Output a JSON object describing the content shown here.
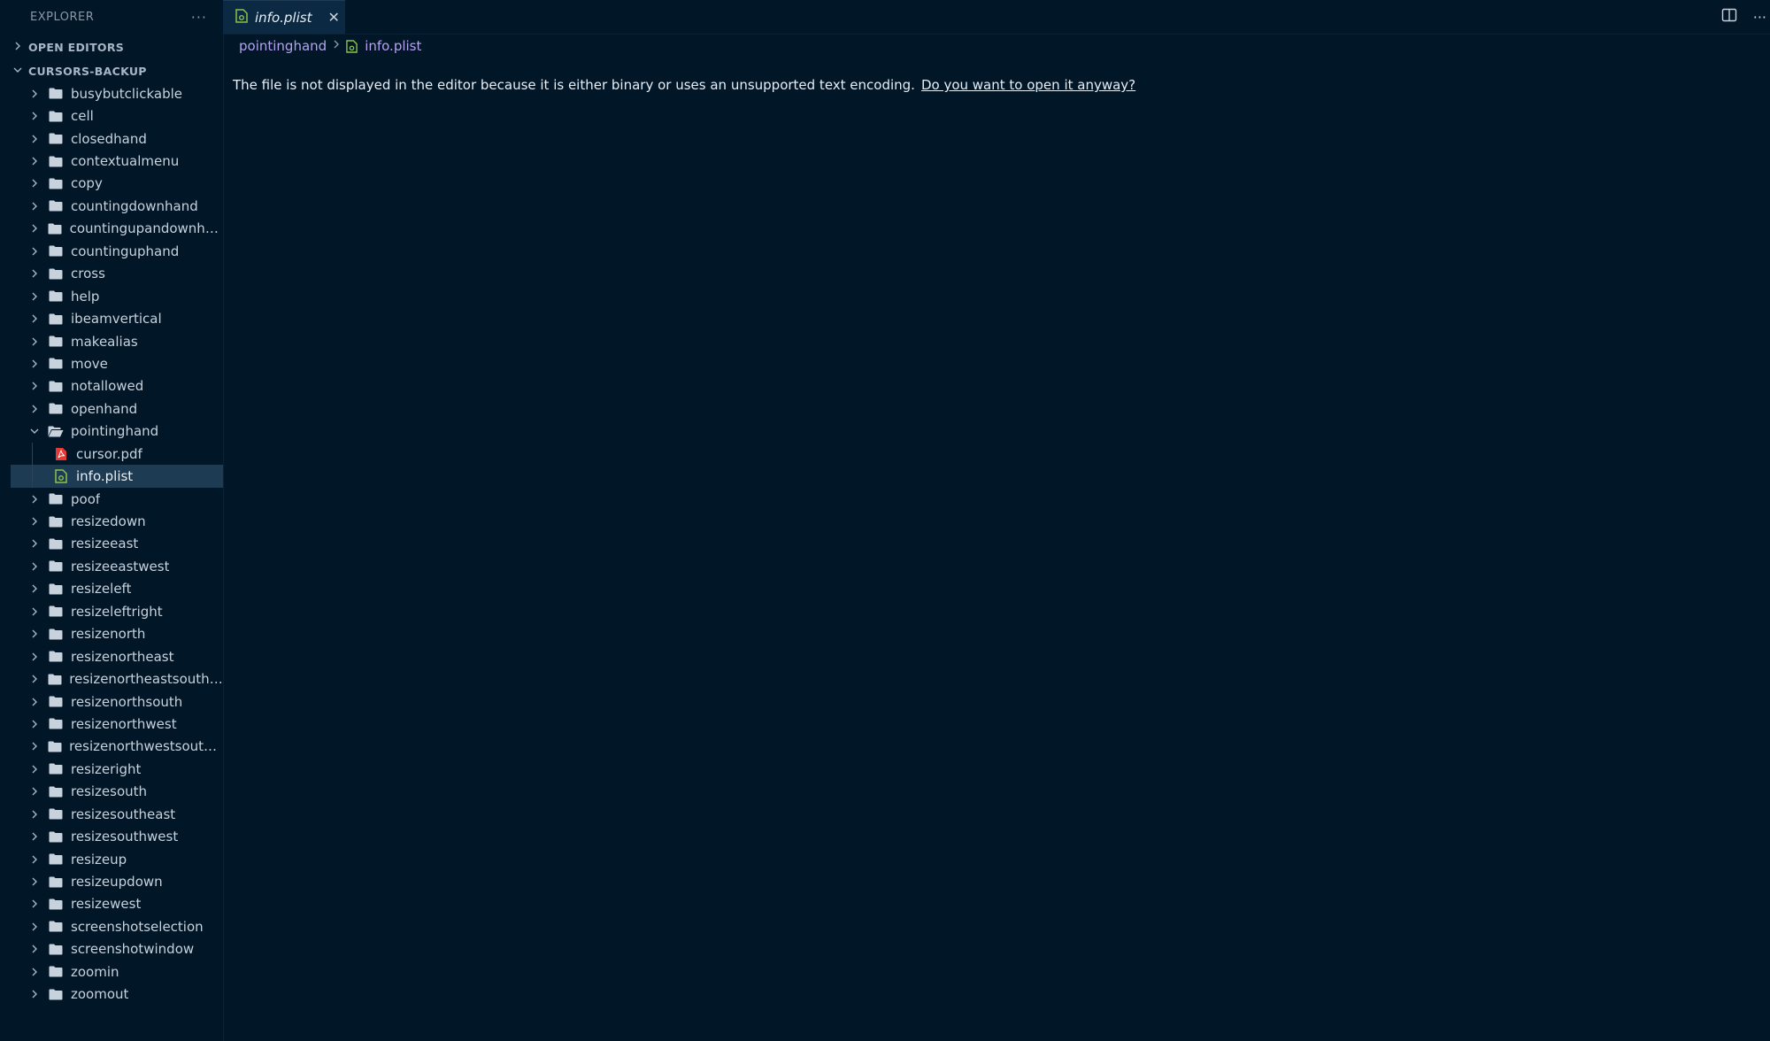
{
  "explorer": {
    "title": "EXPLORER",
    "more": "···"
  },
  "open_editors": {
    "label": "OPEN EDITORS"
  },
  "workspace": {
    "label": "CURSORS-BACKUP"
  },
  "tree": {
    "folders_before": [
      "busybutclickable",
      "cell",
      "closedhand",
      "contextualmenu",
      "copy",
      "countingdownhand",
      "countingupandownhand",
      "countinguphand",
      "cross",
      "help",
      "ibeamvertical",
      "makealias",
      "move",
      "notallowed",
      "openhand"
    ],
    "open_folder": "pointinghand",
    "open_folder_files": [
      {
        "name": "cursor.pdf",
        "icon": "pdf-file-icon"
      },
      {
        "name": "info.plist",
        "icon": "plist-file-icon",
        "selected": true
      }
    ],
    "folders_after": [
      "poof",
      "resizedown",
      "resizeeast",
      "resizeeastwest",
      "resizeleft",
      "resizeleftright",
      "resizenorth",
      "resizenortheast",
      "resizenortheastsouthw...",
      "resizenorthsouth",
      "resizenorthwest",
      "resizenorthwestsouthe...",
      "resizeright",
      "resizesouth",
      "resizesoutheast",
      "resizesouthwest",
      "resizeup",
      "resizeupdown",
      "resizewest",
      "screenshotselection",
      "screenshotwindow",
      "zoomin",
      "zoomout"
    ]
  },
  "tab": {
    "label": "info.plist",
    "close": "✕"
  },
  "breadcrumb": {
    "folder": "pointinghand",
    "file": "info.plist"
  },
  "message": {
    "text": "The file is not displayed in the editor because it is either binary or uses an unsupported text encoding.",
    "link": "Do you want to open it anyway?"
  },
  "colors": {
    "background": "#011627",
    "selected_row": "#1d3b53",
    "breadcrumb": "#b4a4f0",
    "plist_icon": "#8bc34a",
    "pdf_icon": "#e53935"
  }
}
